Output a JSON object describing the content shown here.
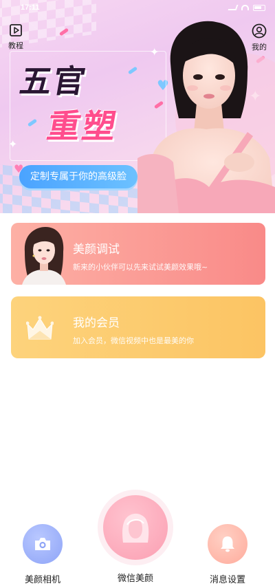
{
  "status_bar": {
    "time": "17:11"
  },
  "header": {
    "tutorial_label": "教程",
    "mine_label": "我的"
  },
  "hero": {
    "title_line1": "五官",
    "title_line2": "重塑",
    "subtitle": "定制专属于你的高级脸"
  },
  "cards": [
    {
      "title": "美颜调试",
      "description": "新来的小伙伴可以先来试试美颜效果哦~"
    },
    {
      "title": "我的会员",
      "description": "加入会员，微信视频中也是最美的你"
    }
  ],
  "bottom_nav": {
    "camera_label": "美颜相机",
    "wechat_beauty_label": "微信美颜",
    "message_settings_label": "消息设置"
  },
  "colors": {
    "hero_pink": "#f7d7f2",
    "title_pink": "#ff4d8d",
    "subtitle_blue": "#4aa3ff",
    "beauty_card": "#f98a88",
    "member_card": "#fcc463",
    "camera_blue": "#8ea4f7",
    "wechat_pink": "#fb9fb2",
    "message_peach": "#ffab9c"
  },
  "icons": {
    "tutorial": "play-square-icon",
    "mine": "user-avatar-icon",
    "member": "crown-icon",
    "camera": "camera-icon",
    "wechat_beauty": "face-silhouette-icon",
    "message": "bell-icon"
  }
}
